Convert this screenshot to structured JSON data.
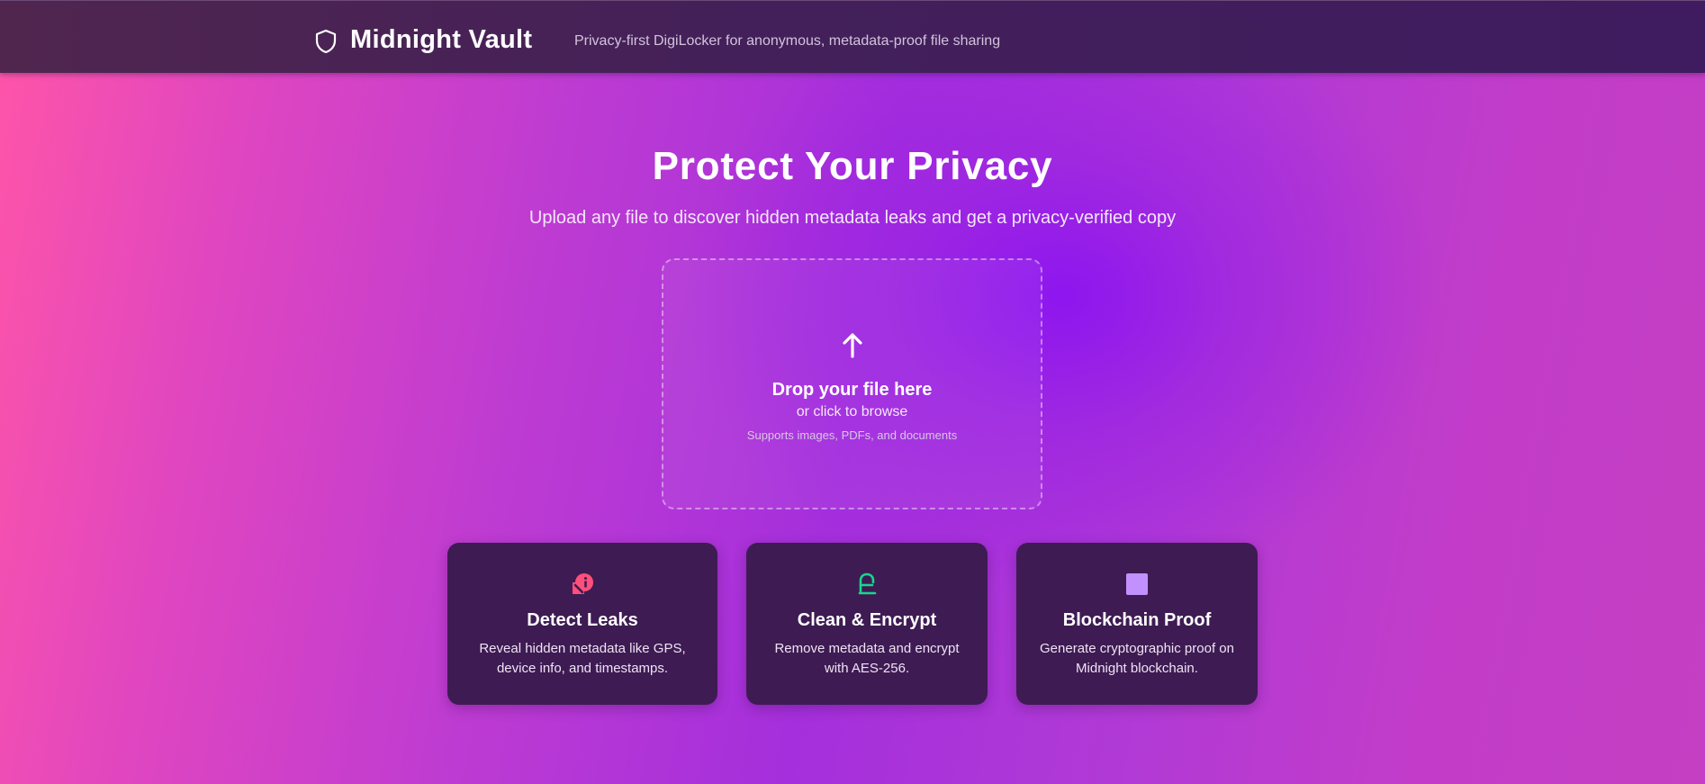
{
  "header": {
    "logo_icon": "shield-icon",
    "title": "Midnight Vault",
    "tagline": "Privacy-first DigiLocker for anonymous, metadata-proof file sharing"
  },
  "hero": {
    "title": "Protect Your Privacy",
    "subtitle": "Upload any file to discover hidden metadata leaks and get a privacy-verified copy"
  },
  "dropzone": {
    "icon": "upload-arrow-icon",
    "title": "Drop your file here",
    "browse_text": "or click to browse",
    "support_text": "Supports images, PDFs, and documents"
  },
  "features": [
    {
      "icon": "leak-detect-icon",
      "icon_color": "#ff4f7b",
      "title": "Detect Leaks",
      "description": "Reveal hidden metadata like GPS, device info, and timestamps."
    },
    {
      "icon": "lock-icon",
      "icon_color": "#19d68c",
      "title": "Clean & Encrypt",
      "description": "Remove metadata and encrypt with AES-256."
    },
    {
      "icon": "block-icon",
      "icon_color": "#c391ff",
      "title": "Blockchain Proof",
      "description": "Generate cryptographic proof on Midnight blockchain."
    }
  ],
  "colors": {
    "header_bg": "#43205a",
    "card_bg": "#3e1b53",
    "gradient_left": "#ff55a8",
    "gradient_center": "#8f14ec"
  }
}
